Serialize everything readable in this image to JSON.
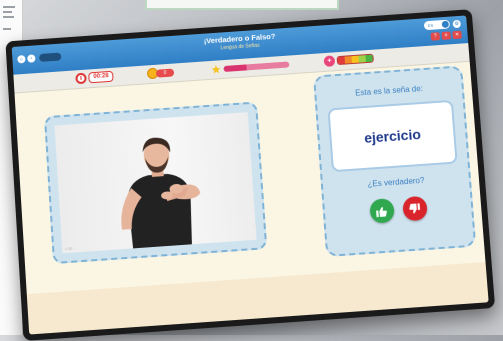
{
  "game": {
    "title": "¡Verdadero o Falso?",
    "subtitle": "Lengua de Señas"
  },
  "toolbar": {
    "lang_toggle": "ES",
    "buttons": [
      "?",
      "≡",
      "✕"
    ]
  },
  "status": {
    "timer": "00:28",
    "coins": "0",
    "progress": 0.35,
    "energy_colors": [
      "#e23b3b",
      "#f08a2b",
      "#f6c21e",
      "#9bd24a",
      "#4bb543"
    ]
  },
  "prompt": {
    "label": "Esta es la seña de:",
    "word": "ejercicio",
    "question": "¿Es verdadero?"
  },
  "video": {
    "watermark": "LSE"
  },
  "colors": {
    "header": "#2f7fc6",
    "true": "#2fa84f",
    "false": "#d9242c",
    "word": "#1e3a8a"
  },
  "icons": {
    "true": "thumbs-up-icon",
    "false": "thumbs-down-icon",
    "timer": "clock-icon",
    "coins": "coin-icon",
    "progress": "star-icon",
    "energy": "heart-icon"
  }
}
